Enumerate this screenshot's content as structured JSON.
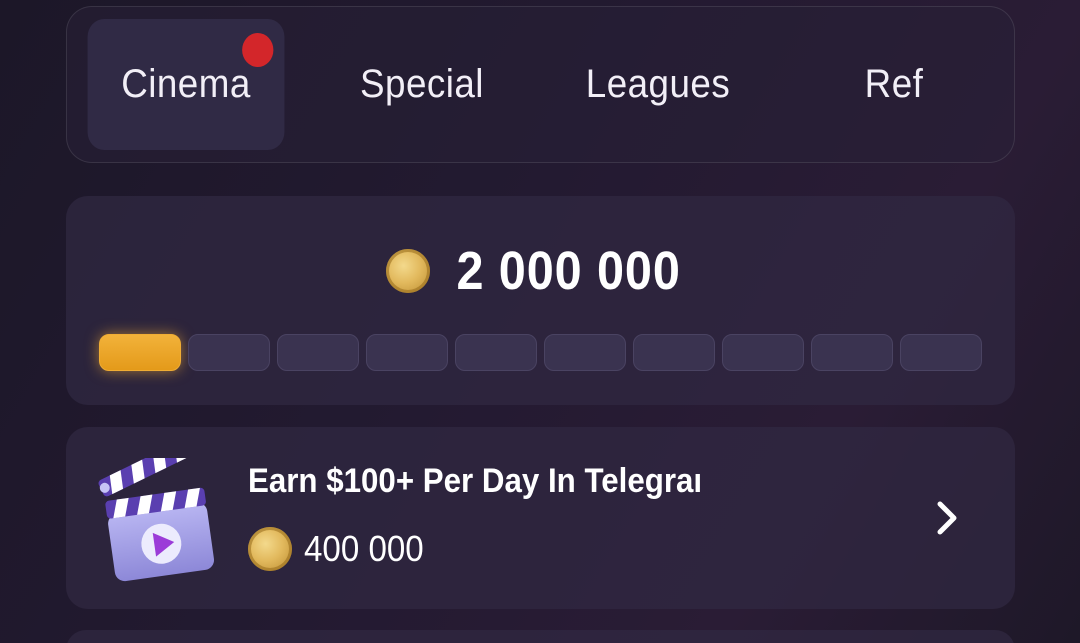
{
  "tabs": [
    {
      "label": "Cinema",
      "active": true,
      "badge": true
    },
    {
      "label": "Special",
      "active": false
    },
    {
      "label": "Leagues",
      "active": false
    },
    {
      "label": "Ref",
      "active": false
    }
  ],
  "balance": {
    "icon": "coin-icon",
    "value": "2 000 000"
  },
  "progress": {
    "total_segments": 10,
    "filled_segments": 1,
    "accent": "#f0a72a"
  },
  "task": {
    "icon": "clapperboard-icon",
    "title": "Earn $100+ Per Day In Telegraı",
    "reward_icon": "coin-icon",
    "reward": "400 000",
    "action_icon": "chevron-right-icon"
  },
  "colors": {
    "badge": "#d3262a",
    "background": "#221a2e",
    "card": "#302840"
  }
}
